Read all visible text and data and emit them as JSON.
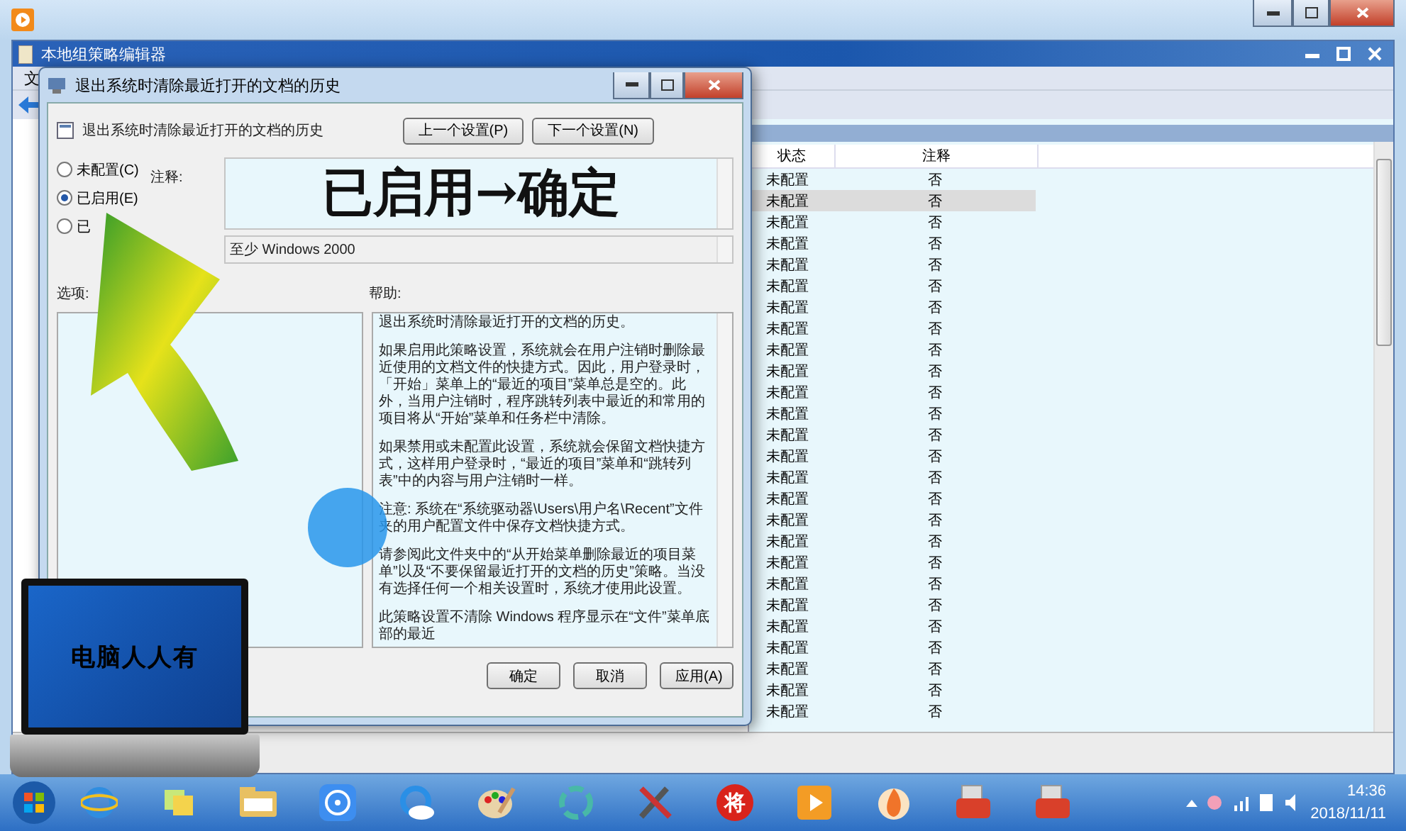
{
  "gpo_window": {
    "title": "本地组策略编辑器",
    "menu_partial": "文",
    "columns": [
      "状态",
      "注释"
    ],
    "rows": [
      {
        "state": "未配置",
        "comment": "否",
        "selected": false
      },
      {
        "state": "未配置",
        "comment": "否",
        "selected": true
      },
      {
        "state": "未配置",
        "comment": "否",
        "selected": false
      },
      {
        "state": "未配置",
        "comment": "否",
        "selected": false
      },
      {
        "state": "未配置",
        "comment": "否",
        "selected": false
      },
      {
        "state": "未配置",
        "comment": "否",
        "selected": false
      },
      {
        "state": "未配置",
        "comment": "否",
        "selected": false
      },
      {
        "state": "未配置",
        "comment": "否",
        "selected": false
      },
      {
        "state": "未配置",
        "comment": "否",
        "selected": false
      },
      {
        "state": "未配置",
        "comment": "否",
        "selected": false
      },
      {
        "state": "未配置",
        "comment": "否",
        "selected": false
      },
      {
        "state": "未配置",
        "comment": "否",
        "selected": false
      },
      {
        "state": "未配置",
        "comment": "否",
        "selected": false
      },
      {
        "state": "未配置",
        "comment": "否",
        "selected": false
      },
      {
        "state": "未配置",
        "comment": "否",
        "selected": false
      },
      {
        "state": "未配置",
        "comment": "否",
        "selected": false
      },
      {
        "state": "未配置",
        "comment": "否",
        "selected": false
      },
      {
        "state": "未配置",
        "comment": "否",
        "selected": false
      },
      {
        "state": "未配置",
        "comment": "否",
        "selected": false
      },
      {
        "state": "未配置",
        "comment": "否",
        "selected": false
      },
      {
        "state": "未配置",
        "comment": "否",
        "selected": false
      },
      {
        "state": "未配置",
        "comment": "否",
        "selected": false
      },
      {
        "state": "未配置",
        "comment": "否",
        "selected": false
      },
      {
        "state": "未配置",
        "comment": "否",
        "selected": false
      },
      {
        "state": "未配置",
        "comment": "否",
        "selected": false
      },
      {
        "state": "未配置",
        "comment": "否",
        "selected": false
      }
    ]
  },
  "dialog": {
    "title": "退出系统时清除最近打开的文档的历史",
    "heading": "退出系统时清除最近打开的文档的历史",
    "nav_buttons": [
      "上一个设置(P)",
      "下一个设置(N)"
    ],
    "radios": [
      {
        "label": "未配置(C)",
        "selected": false
      },
      {
        "label": "已启用(E)",
        "selected": true
      },
      {
        "label": "已",
        "selected": false
      }
    ],
    "comment_label": "注释:",
    "supported_on": "至少 Windows 2000",
    "options_label": "选项:",
    "help_label": "帮助:",
    "help_paragraphs": [
      "退出系统时清除最近打开的文档的历史。",
      "如果启用此策略设置，系统就会在用户注销时删除最近使用的文档文件的快捷方式。因此，用户登录时，「开始」菜单上的“最近的项目”菜单总是空的。此外，当用户注销时，程序跳转列表中最近的和常用的项目将从“开始”菜单和任务栏中清除。",
      "如果禁用或未配置此设置，系统就会保留文档快捷方式，这样用户登录时，“最近的项目”菜单和“跳转列表”中的内容与用户注销时一样。",
      "注意: 系统在“系统驱动器\\Users\\用户名\\Recent”文件夹的用户配置文件中保存文档快捷方式。",
      "请参阅此文件夹中的“从开始菜单删除最近的项目菜单”以及“不要保留最近打开的文档的历史”策略。当没有选择任何一个相关设置时，系统才使用此设置。",
      "此策略设置不清除 Windows 程序显示在“文件”菜单底部的最近"
    ],
    "buttons": [
      "确定",
      "取消",
      "应用(A)"
    ]
  },
  "overlay": {
    "caption": "已启用→确定",
    "logo_text": "电脑人人有"
  },
  "taskbar": {
    "apps": [
      {
        "kind": "ie"
      },
      {
        "kind": "notes"
      },
      {
        "kind": "folder"
      },
      {
        "kind": "video"
      },
      {
        "kind": "cloud"
      },
      {
        "kind": "paint"
      },
      {
        "kind": "swirl"
      },
      {
        "kind": "tools"
      },
      {
        "kind": "badge",
        "text": "将"
      },
      {
        "kind": "player"
      },
      {
        "kind": "flame"
      },
      {
        "kind": "toolbox"
      },
      {
        "kind": "toolbox"
      }
    ],
    "time": "14:36",
    "date": "2018/11/11"
  }
}
